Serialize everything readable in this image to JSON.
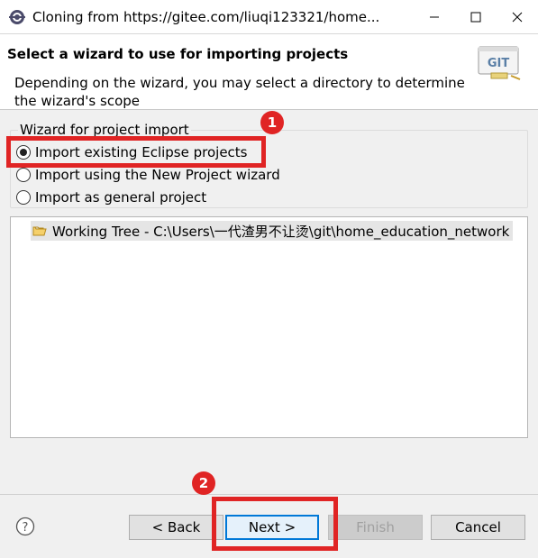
{
  "window": {
    "title": "Cloning from https://gitee.com/liuqi123321/home...",
    "icon": "eclipse-icon",
    "controls": [
      "minimize-icon",
      "maximize-icon",
      "close-icon"
    ]
  },
  "wizard": {
    "title": "Select a wizard to use for importing projects",
    "description": "Depending on the wizard, you may select a directory to determine the wizard's scope",
    "logo_text": "GIT"
  },
  "import_group": {
    "label": "Wizard for project import",
    "options": [
      {
        "label": "Import existing Eclipse projects",
        "selected": true
      },
      {
        "label": "Import using the New Project wizard",
        "selected": false
      },
      {
        "label": "Import as general project",
        "selected": false
      }
    ]
  },
  "tree": {
    "items": [
      {
        "label": "Working Tree - C:\\Users\\一代渣男不让烫\\git\\home_education_network",
        "icon": "folder-open-icon"
      }
    ]
  },
  "buttons": {
    "back": "< Back",
    "next": "Next >",
    "finish": "Finish",
    "cancel": "Cancel"
  },
  "annotations": [
    "1",
    "2"
  ],
  "colors": {
    "annotation": "#e02424",
    "default_button_border": "#0078d7"
  }
}
